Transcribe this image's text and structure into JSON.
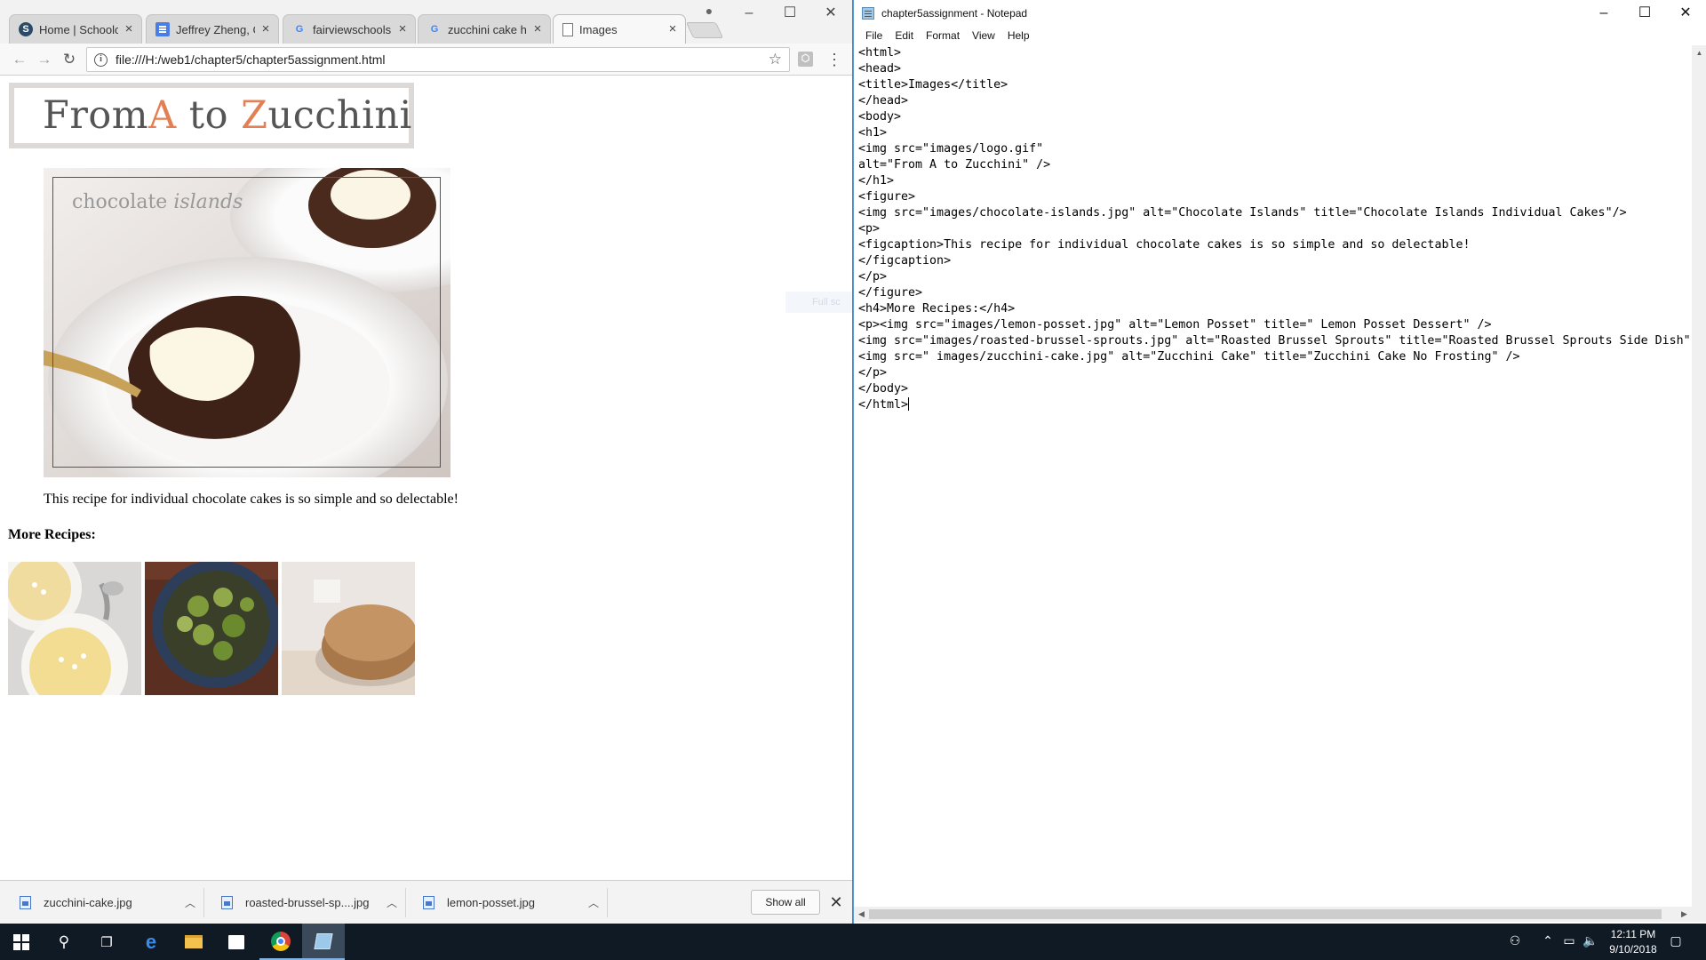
{
  "chrome": {
    "tabs": [
      {
        "title": "Home | Schoology",
        "icon": "schoology-icon"
      },
      {
        "title": "Jeffrey Zheng, Ca",
        "icon": "google-docs-icon"
      },
      {
        "title": "fairviewschools.p",
        "icon": "google-icon"
      },
      {
        "title": "zucchini cake htm",
        "icon": "google-icon"
      },
      {
        "title": "Images",
        "icon": "page-icon"
      }
    ],
    "url": "file:///H:/web1/chapter5/chapter5assignment.html",
    "page": {
      "logo_part1": "From ",
      "logo_a": "A",
      "logo_part2": " to ",
      "logo_z": "Z",
      "logo_part3": "ucchini",
      "hero_label_plain": "chocolate ",
      "hero_label_italic": "islands",
      "caption": "This recipe for individual chocolate cakes is so simple and so delectable!",
      "more_recipes": "More Recipes:",
      "thumbnails": [
        "lemon-posset",
        "roasted-brussel-sprouts",
        "zucchini-cake"
      ]
    },
    "downloads": [
      {
        "name": "zucchini-cake.jpg"
      },
      {
        "name": "roasted-brussel-sp....jpg"
      },
      {
        "name": "lemon-posset.jpg"
      }
    ],
    "show_all": "Show all"
  },
  "notepad": {
    "title": "chapter5assignment - Notepad",
    "menu": [
      "File",
      "Edit",
      "Format",
      "View",
      "Help"
    ],
    "lines": [
      "<html>",
      "<head>",
      "<title>Images</title>",
      "</head>",
      "<body>",
      "<h1>",
      "<img src=\"images/logo.gif\"",
      "alt=\"From A to Zucchini\" />",
      "</h1>",
      "<figure>",
      "<img src=\"images/chocolate-islands.jpg\" alt=\"Chocolate Islands\" title=\"Chocolate Islands Individual Cakes\"/>",
      "<p>",
      "<figcaption>This recipe for individual chocolate cakes is so simple and so delectable!",
      "</figcaption>",
      "</p>",
      "</figure>",
      "<h4>More Recipes:</h4>",
      "<p><img src=\"images/lemon-posset.jpg\" alt=\"Lemon Posset\" title=\" Lemon Posset Dessert\" />",
      "<img src=\"images/roasted-brussel-sprouts.jpg\" alt=\"Roasted Brussel Sprouts\" title=\"Roasted Brussel Sprouts Side Dish\"",
      "<img src=\" images/zucchini-cake.jpg\" alt=\"Zucchini Cake\" title=\"Zucchini Cake No Frosting\" />",
      "</p>",
      "</body>",
      "</html>"
    ]
  },
  "taskbar": {
    "time": "12:11 PM",
    "date": "9/10/2018"
  }
}
